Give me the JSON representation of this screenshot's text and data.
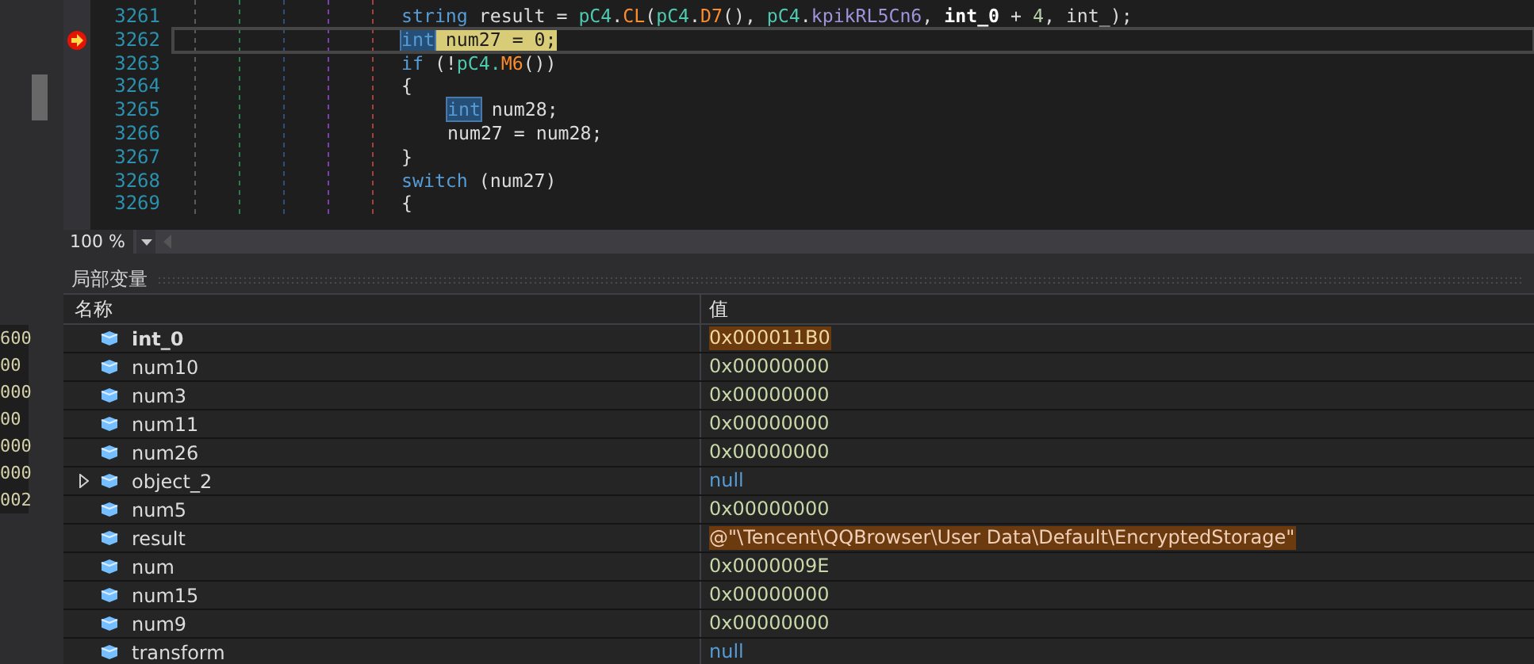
{
  "side_panel": {
    "values": [
      "600",
      "00",
      "000",
      "00",
      "000",
      "000",
      "002"
    ]
  },
  "code_lines": [
    {
      "number": "3261",
      "current": false,
      "tokens": [
        {
          "text": "string",
          "kind": "keyword"
        },
        {
          "text": " result = ",
          "kind": "plain"
        },
        {
          "text": "pC4",
          "kind": "type"
        },
        {
          "text": ".",
          "kind": "plain"
        },
        {
          "text": "CL",
          "kind": "method"
        },
        {
          "text": "(",
          "kind": "plain"
        },
        {
          "text": "pC4",
          "kind": "type"
        },
        {
          "text": ".",
          "kind": "plain"
        },
        {
          "text": "D7",
          "kind": "method"
        },
        {
          "text": "(), ",
          "kind": "plain"
        },
        {
          "text": "pC4",
          "kind": "type"
        },
        {
          "text": ".",
          "kind": "plain"
        },
        {
          "text": "kpikRL5Cn6",
          "kind": "field"
        },
        {
          "text": ", ",
          "kind": "plain"
        },
        {
          "text": "int_0",
          "kind": "parameter"
        },
        {
          "text": " + ",
          "kind": "plain"
        },
        {
          "text": "4",
          "kind": "number"
        },
        {
          "text": ", int_);",
          "kind": "plain"
        }
      ]
    },
    {
      "number": "3262",
      "current": true,
      "tokens": [
        {
          "text": "int",
          "kind": "keyword",
          "highlighted": true
        },
        {
          "text": " num27 = 0;",
          "kind": "statement"
        }
      ]
    },
    {
      "number": "3263",
      "current": false,
      "tokens": [
        {
          "text": "if",
          "kind": "keyword"
        },
        {
          "text": " (!",
          "kind": "plain"
        },
        {
          "text": "pC4.",
          "kind": "type"
        },
        {
          "text": "M6",
          "kind": "method"
        },
        {
          "text": "())",
          "kind": "plain"
        }
      ]
    },
    {
      "number": "3264",
      "current": false,
      "tokens": [
        {
          "text": "{",
          "kind": "plain"
        }
      ],
      "children": [
        {
          "number": "3265",
          "current": false,
          "tokens": [
            {
              "text": "int",
              "kind": "keyword",
              "highlighted": true
            },
            {
              "text": " num28;",
              "kind": "plain"
            }
          ]
        },
        {
          "number": "3266",
          "current": false,
          "tokens": [
            {
              "text": "num27 = num28;",
              "kind": "plain"
            }
          ]
        }
      ]
    },
    {
      "number": "3267",
      "current": false,
      "tokens": [
        {
          "text": "}",
          "kind": "plain"
        }
      ]
    },
    {
      "number": "3268",
      "current": false,
      "tokens": [
        {
          "text": "switch",
          "kind": "keyword"
        },
        {
          "text": " (num27)",
          "kind": "plain"
        }
      ]
    },
    {
      "number": "3269",
      "current": false,
      "tokens": [
        {
          "text": "{",
          "kind": "plain"
        }
      ]
    }
  ],
  "zoom": {
    "value": "100 %"
  },
  "locals": {
    "title": "局部变量",
    "columns": [
      "名称",
      "值"
    ],
    "rows": [
      {
        "name": "int_0",
        "kind": "parameter",
        "expandable": false,
        "value": {
          "text": "0x000011B0",
          "kind": "number"
        },
        "changed": true
      },
      {
        "name": "num10",
        "kind": "local",
        "expandable": false,
        "value": {
          "text": "0x00000000",
          "kind": "number"
        },
        "changed": false
      },
      {
        "name": "num3",
        "kind": "local",
        "expandable": false,
        "value": {
          "text": "0x00000000",
          "kind": "number"
        },
        "changed": false
      },
      {
        "name": "num11",
        "kind": "local",
        "expandable": false,
        "value": {
          "text": "0x00000000",
          "kind": "number"
        },
        "changed": false
      },
      {
        "name": "num26",
        "kind": "local",
        "expandable": false,
        "value": {
          "text": "0x00000000",
          "kind": "number"
        },
        "changed": false
      },
      {
        "name": "object_2",
        "kind": "local",
        "expandable": true,
        "value": {
          "text": "null",
          "kind": "null"
        },
        "changed": false
      },
      {
        "name": "num5",
        "kind": "local",
        "expandable": false,
        "value": {
          "text": "0x00000000",
          "kind": "number"
        },
        "changed": false
      },
      {
        "name": "result",
        "kind": "local",
        "expandable": false,
        "value": {
          "text": "@\"\\Tencent\\QQBrowser\\User Data\\Default\\EncryptedStorage\"",
          "kind": "string"
        },
        "changed": true
      },
      {
        "name": "num",
        "kind": "local",
        "expandable": false,
        "value": {
          "text": "0x0000009E",
          "kind": "number"
        },
        "changed": false
      },
      {
        "name": "num15",
        "kind": "local",
        "expandable": false,
        "value": {
          "text": "0x00000000",
          "kind": "number"
        },
        "changed": false
      },
      {
        "name": "num9",
        "kind": "local",
        "expandable": false,
        "value": {
          "text": "0x00000000",
          "kind": "number"
        },
        "changed": false
      },
      {
        "name": "transform",
        "kind": "local",
        "expandable": false,
        "value": {
          "text": "null",
          "kind": "null"
        },
        "changed": false
      }
    ]
  }
}
